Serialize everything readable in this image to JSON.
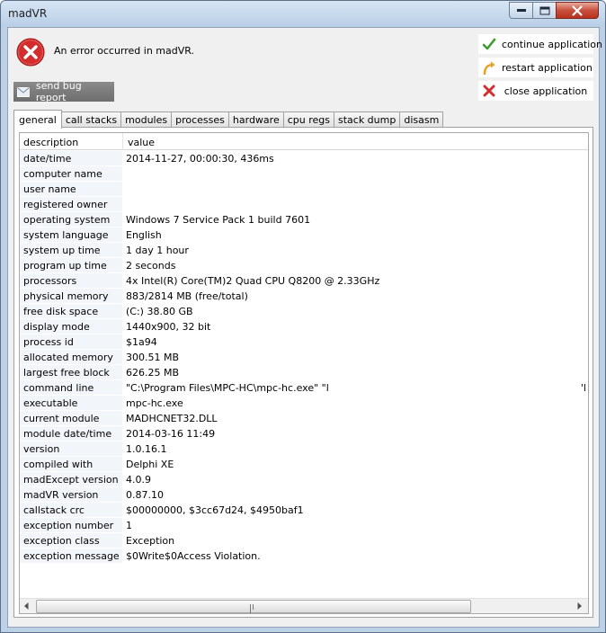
{
  "window": {
    "title": "madVR"
  },
  "header": {
    "error_message": "An error occurred in madVR."
  },
  "actions": {
    "continue_label": "continue application",
    "restart_label": "restart application",
    "close_label": "close application",
    "bug_report_label": "send bug report"
  },
  "tabs": [
    "general",
    "call stacks",
    "modules",
    "processes",
    "hardware",
    "cpu regs",
    "stack dump",
    "disasm"
  ],
  "table": {
    "headers": {
      "description": "description",
      "value": "value"
    },
    "rows": [
      {
        "key": "date/time",
        "value": "2014-11-27, 00:00:30, 436ms"
      },
      {
        "key": "computer name",
        "value": ""
      },
      {
        "key": "user name",
        "value": ""
      },
      {
        "key": "registered owner",
        "value": ""
      },
      {
        "key": "operating system",
        "value": "Windows 7 Service Pack 1 build 7601"
      },
      {
        "key": "system language",
        "value": "English"
      },
      {
        "key": "system up time",
        "value": "1 day 1 hour"
      },
      {
        "key": "program up time",
        "value": "2 seconds"
      },
      {
        "key": "processors",
        "value": "4x Intel(R) Core(TM)2 Quad CPU Q8200 @ 2.33GHz"
      },
      {
        "key": "physical memory",
        "value": "883/2814 MB (free/total)"
      },
      {
        "key": "free disk space",
        "value": "(C:) 38.80 GB"
      },
      {
        "key": "display mode",
        "value": "1440x900, 32 bit"
      },
      {
        "key": "process id",
        "value": "$1a94"
      },
      {
        "key": "allocated memory",
        "value": "300.51 MB"
      },
      {
        "key": "largest free block",
        "value": "626.25 MB"
      },
      {
        "key": "command line",
        "value": "\"C:\\Program Files\\MPC-HC\\mpc-hc.exe\" \"l",
        "tail": "'l"
      },
      {
        "key": "executable",
        "value": "mpc-hc.exe"
      },
      {
        "key": "current module",
        "value": "MADHCNET32.DLL"
      },
      {
        "key": "module date/time",
        "value": "2014-03-16 11:49"
      },
      {
        "key": "version",
        "value": "1.0.16.1"
      },
      {
        "key": "compiled with",
        "value": "Delphi XE"
      },
      {
        "key": "madExcept version",
        "value": "4.0.9"
      },
      {
        "key": "madVR version",
        "value": "0.87.10"
      },
      {
        "key": "callstack crc",
        "value": "$00000000, $3cc67d24, $4950baf1"
      },
      {
        "key": "exception number",
        "value": "1"
      },
      {
        "key": "exception class",
        "value": "Exception"
      },
      {
        "key": "exception message",
        "value": "$0Write$0Access Violation."
      }
    ]
  },
  "icons": {
    "error": "error-x-circle-icon",
    "continue": "checkmark-icon",
    "restart": "restart-arrow-icon",
    "close": "red-x-icon",
    "bug_report": "envelope-icon"
  },
  "colors": {
    "error_red": "#d42d2d",
    "check_green": "#3f9b2c",
    "restart_orange": "#e3a12e"
  },
  "scrollbar": {
    "horizontal_position": 0,
    "horizontal_visible_fraction": 0.77
  }
}
